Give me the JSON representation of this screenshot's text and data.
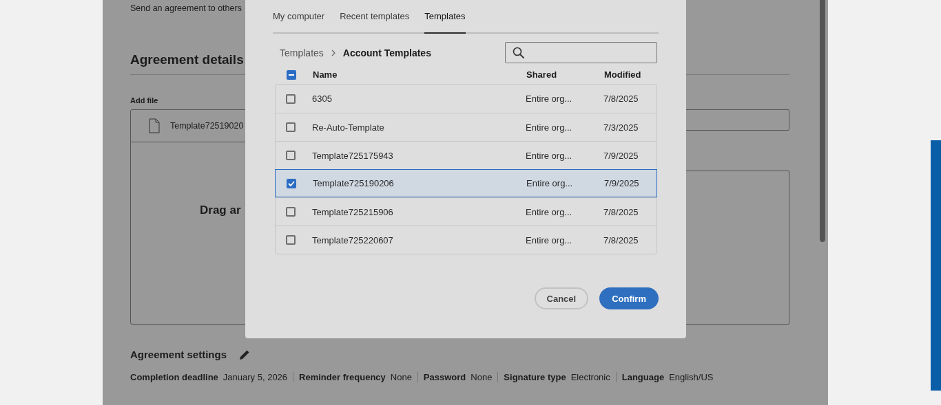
{
  "page": {
    "intro": "Send an agreement to others",
    "heading": "Agreement details",
    "add_file_label": "Add file",
    "file_name": "Template72519020",
    "drop_text": "Drag ar"
  },
  "settings": {
    "title": "Agreement settings",
    "items": [
      {
        "label": "Completion deadline",
        "value": "January 5, 2026"
      },
      {
        "label": "Reminder frequency",
        "value": "None"
      },
      {
        "label": "Password",
        "value": "None"
      },
      {
        "label": "Signature type",
        "value": "Electronic"
      },
      {
        "label": "Language",
        "value": "English/US"
      }
    ]
  },
  "dialog": {
    "tabs": [
      {
        "label": "My computer",
        "selected": false
      },
      {
        "label": "Recent templates",
        "selected": false
      },
      {
        "label": "Templates",
        "selected": true
      }
    ],
    "breadcrumb": [
      "Templates",
      "Account Templates"
    ],
    "select_all": {
      "indeterminate": true
    },
    "columns": [
      "Name",
      "Shared",
      "Modified"
    ],
    "rows": [
      {
        "name": "6305",
        "shared": "Entire org...",
        "modified": "7/8/2025",
        "selected": false
      },
      {
        "name": "Re-Auto-Template",
        "shared": "Entire org...",
        "modified": "7/3/2025",
        "selected": false
      },
      {
        "name": "Template725175943",
        "shared": "Entire org...",
        "modified": "7/9/2025",
        "selected": false
      },
      {
        "name": "Template725190206",
        "shared": "Entire org...",
        "modified": "7/9/2025",
        "selected": true
      },
      {
        "name": "Template725215906",
        "shared": "Entire org...",
        "modified": "7/8/2025",
        "selected": false
      },
      {
        "name": "Template725220607",
        "shared": "Entire org...",
        "modified": "7/8/2025",
        "selected": false
      }
    ],
    "buttons": [
      {
        "label": "Cancel",
        "kind": "secondary"
      },
      {
        "label": "Confirm",
        "kind": "primary"
      }
    ]
  }
}
